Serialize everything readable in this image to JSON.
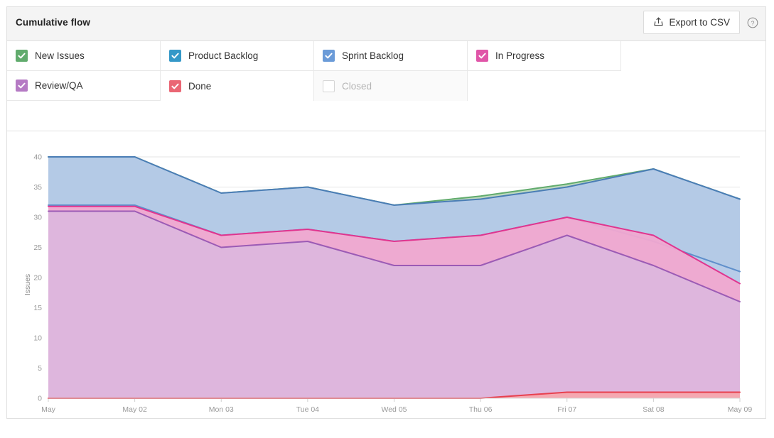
{
  "header": {
    "title": "Cumulative flow",
    "export_label": "Export to CSV",
    "export_icon": "upload-share-icon",
    "help_icon": "help-circle-icon"
  },
  "legend": {
    "items": [
      {
        "label": "New Issues",
        "color": "#61ab6d",
        "checked": true,
        "disabled": false
      },
      {
        "label": "Product Backlog",
        "color": "#3498c8",
        "checked": true,
        "disabled": false
      },
      {
        "label": "Sprint Backlog",
        "color": "#6b9bd8",
        "checked": true,
        "disabled": false
      },
      {
        "label": "In Progress",
        "color": "#e055a8",
        "checked": true,
        "disabled": false
      },
      {
        "label": "Review/QA",
        "color": "#b57ac4",
        "checked": true,
        "disabled": false
      },
      {
        "label": "Done",
        "color": "#ea6674",
        "checked": true,
        "disabled": false
      },
      {
        "label": "Closed",
        "color": "#ffffff",
        "checked": false,
        "disabled": true
      }
    ]
  },
  "chart_data": {
    "type": "area",
    "title": "Cumulative flow",
    "xlabel": "",
    "ylabel": "Issues",
    "ylim": [
      0,
      40
    ],
    "yticks": [
      0,
      5,
      10,
      15,
      20,
      25,
      30,
      35,
      40
    ],
    "grid": true,
    "legend_position": "top",
    "stacked": false,
    "categories": [
      "May",
      "May 02",
      "Mon 03",
      "Tue 04",
      "Wed 05",
      "Thu 06",
      "Fri 07",
      "Sat 08",
      "May 09"
    ],
    "series": [
      {
        "name": "New Issues",
        "color": "#61ab6d",
        "fill": "#b9d7bc",
        "values": [
          40,
          40,
          34,
          35,
          32,
          33.5,
          35.5,
          38,
          33
        ]
      },
      {
        "name": "Product Backlog",
        "color": "#4a7db5",
        "fill": "#b3c9e8",
        "values": [
          40,
          40,
          34,
          35,
          32,
          33,
          35,
          38,
          33
        ]
      },
      {
        "name": "Sprint Backlog",
        "color": "#5f8fcb",
        "fill": "#b8cbe8",
        "values": [
          32,
          32,
          27,
          28,
          26,
          27,
          30,
          26,
          21
        ]
      },
      {
        "name": "In Progress",
        "color": "#e0358f",
        "fill": "#f0a8d0",
        "values": [
          31.8,
          31.8,
          27,
          28,
          26,
          27,
          30,
          27,
          19
        ]
      },
      {
        "name": "Review/QA",
        "color": "#9b5bb5",
        "fill": "#dcb6dd",
        "values": [
          31,
          31,
          25,
          26,
          22,
          22,
          27,
          22,
          16
        ]
      },
      {
        "name": "Done",
        "color": "#e8404f",
        "fill": "#f5a8ae",
        "values": [
          0,
          0,
          0,
          0,
          0,
          0,
          1,
          1,
          1
        ]
      }
    ]
  }
}
